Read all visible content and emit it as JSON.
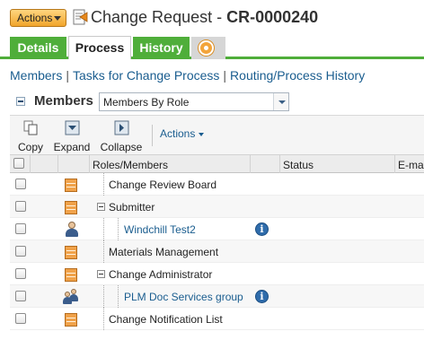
{
  "header": {
    "actions_label": "Actions",
    "title_prefix": "Change Request - ",
    "title_id": "CR-0000240"
  },
  "tabs": [
    {
      "label": "Details",
      "style": "green"
    },
    {
      "label": "Process",
      "style": "active"
    },
    {
      "label": "History",
      "style": "green"
    },
    {
      "label": "",
      "icon": "add-tab-icon"
    }
  ],
  "links": {
    "members": "Members",
    "tasks": "Tasks for Change Process",
    "routing": "Routing/Process History",
    "separator": "|"
  },
  "members_section": {
    "title": "Members",
    "view_select_value": "Members By Role"
  },
  "toolbar": {
    "copy_label": "Copy",
    "expand_label": "Expand",
    "collapse_label": "Collapse",
    "actions_label": "Actions"
  },
  "table": {
    "columns": [
      "Roles/Members",
      "Status",
      "E-mail"
    ],
    "rows": [
      {
        "label": "Change Review Board",
        "type": "role",
        "level": 0,
        "expandable": false,
        "info": false
      },
      {
        "label": "Submitter",
        "type": "role",
        "level": 0,
        "expandable": true,
        "info": false
      },
      {
        "label": "Windchill Test2",
        "type": "user",
        "level": 1,
        "expandable": false,
        "info": true
      },
      {
        "label": "Materials Management",
        "type": "role",
        "level": 0,
        "expandable": false,
        "info": false
      },
      {
        "label": "Change Administrator",
        "type": "role",
        "level": 0,
        "expandable": true,
        "info": false
      },
      {
        "label": "PLM Doc Services group",
        "type": "group",
        "level": 1,
        "expandable": false,
        "info": true
      },
      {
        "label": "Change Notification List",
        "type": "role",
        "level": 0,
        "expandable": false,
        "info": false
      }
    ]
  },
  "colors": {
    "tab_green": "#4fae3a",
    "link_blue": "#1a5d8f",
    "actions_orange": "#f1a52c"
  }
}
